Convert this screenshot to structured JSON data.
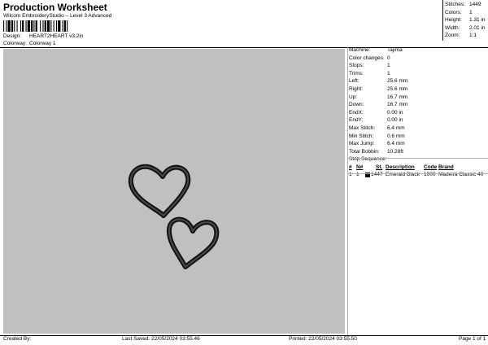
{
  "header": {
    "title": "Production Worksheet",
    "subtitle": "Wilcom EmbroideryStudio – Level 3 Advanced"
  },
  "design": {
    "label": "Design:",
    "value": "HEART2HEART v3.2in"
  },
  "colorway": {
    "label": "Colorway:",
    "value": "Colorway 1"
  },
  "stats": [
    {
      "label": "Stitches:",
      "value": "1449"
    },
    {
      "label": "Colors:",
      "value": "1"
    },
    {
      "label": "Height:",
      "value": "1.31 in"
    },
    {
      "label": "Width:",
      "value": "2.01 in"
    },
    {
      "label": "Zoom:",
      "value": "1:1"
    }
  ],
  "details": [
    {
      "label": "Machine:",
      "value": "Tajima"
    },
    {
      "label": "Color changes:",
      "value": "0"
    },
    {
      "label": "Stops:",
      "value": "1"
    },
    {
      "label": "Trims:",
      "value": "1"
    },
    {
      "label": "Left:",
      "value": "25.6 mm"
    },
    {
      "label": "Right:",
      "value": "25.6 mm"
    },
    {
      "label": "Up:",
      "value": "16.7 mm"
    },
    {
      "label": "Down:",
      "value": "16.7 mm"
    },
    {
      "label": "EndX:",
      "value": "0.00 in"
    },
    {
      "label": "EndY:",
      "value": "0.00 in"
    },
    {
      "label": "Max Stitch:",
      "value": "6.4 mm"
    },
    {
      "label": "Min Stitch:",
      "value": "0.6 mm"
    },
    {
      "label": "Max Jump:",
      "value": "6.4 mm"
    },
    {
      "label": "Total Bobbin:",
      "value": "10.28ft"
    }
  ],
  "stop_sequence": {
    "label": "Stop Sequence:",
    "headers": {
      "num": "#",
      "n": "N#",
      "st": "St.",
      "description": "Description",
      "code": "Code",
      "brand": "Brand"
    },
    "rows": [
      {
        "num": "1",
        "n": "1",
        "st": "1447",
        "description": "Emerald Black",
        "code": "1000",
        "brand": "Madeira Classic 40",
        "color": "#111111"
      }
    ]
  },
  "footer": {
    "created_by": "Created By:",
    "last_saved": "Last Saved: 22/05/2024 03:55.46",
    "printed": "Printed: 22/05/2024 03:55.50",
    "page": "Page 1 of 1"
  },
  "colors": {
    "canvas": "#c0c0c0",
    "heart_outline": "#111111",
    "heart_inner": "#3a3a3a"
  }
}
